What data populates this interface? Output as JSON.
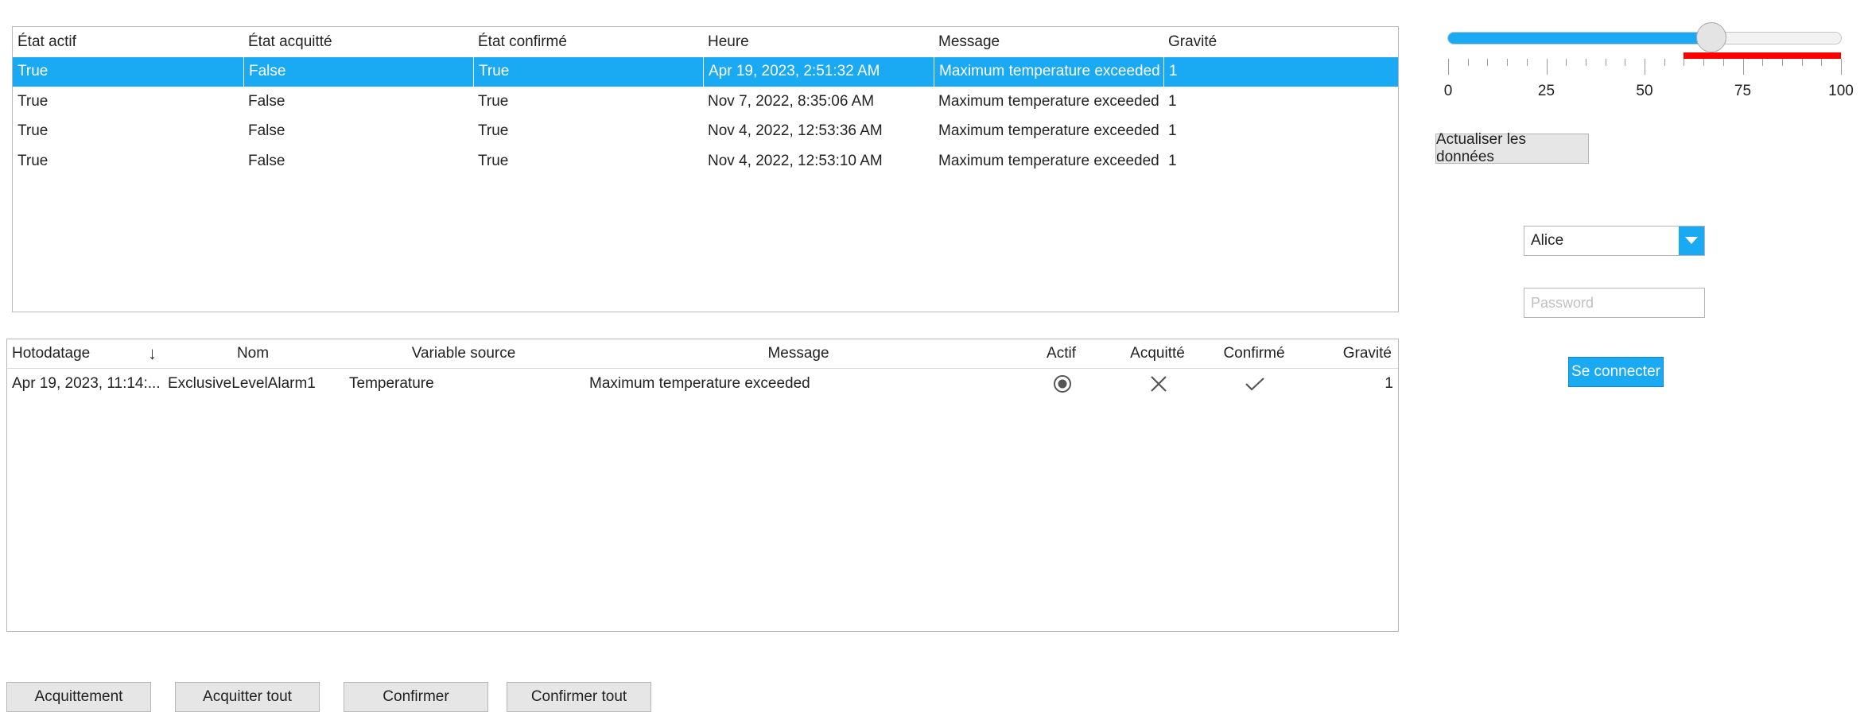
{
  "alarm_grid": {
    "columns": [
      "État actif",
      "État acquitté",
      "État confirmé",
      "Heure",
      "Message",
      "Gravité"
    ],
    "rows": [
      [
        "True",
        "False",
        "True",
        "Apr 19, 2023, 2:51:32 AM",
        "Maximum temperature exceeded",
        "1"
      ],
      [
        "True",
        "False",
        "True",
        "Nov 7, 2022, 8:35:06 AM",
        "Maximum temperature exceeded",
        "1"
      ],
      [
        "True",
        "False",
        "True",
        "Nov 4, 2022, 12:53:36 AM",
        "Maximum temperature exceeded",
        "1"
      ],
      [
        "True",
        "False",
        "True",
        "Nov 4, 2022, 12:53:10 AM",
        "Maximum temperature exceeded",
        "1"
      ]
    ]
  },
  "alarm_banner": {
    "columns": [
      "Hotodatage",
      "Nom",
      "Variable source",
      "Message",
      "Actif",
      "Acquitté",
      "Confirmé",
      "Gravité"
    ],
    "rows": [
      {
        "timestamp": "Apr 19, 2023, 11:14:...",
        "name": "ExclusiveLevelAlarm1",
        "source": "Temperature",
        "message": "Maximum temperature exceeded",
        "active_icon": "radio-selected-icon",
        "acked_icon": "cross-icon",
        "confirmed_icon": "check-icon",
        "severity": "1"
      }
    ]
  },
  "actions": {
    "acknowledge": "Acquittement",
    "acknowledge_all": "Acquitter tout",
    "confirm": "Confirmer",
    "confirm_all": "Confirmer tout"
  },
  "slider": {
    "value": 67,
    "min": 0,
    "max": 100,
    "labels": [
      "0",
      "25",
      "50",
      "75",
      "100"
    ],
    "alarm_zone_start": 60,
    "fill_color": "#1aaaf4",
    "alarm_color": "#ff0000"
  },
  "refresh_button": "Actualiser les données",
  "login": {
    "user_selected": "Alice",
    "password_placeholder": "Password",
    "connect_label": "Se connecter"
  },
  "colors": {
    "accent": "#1aaaf4"
  }
}
